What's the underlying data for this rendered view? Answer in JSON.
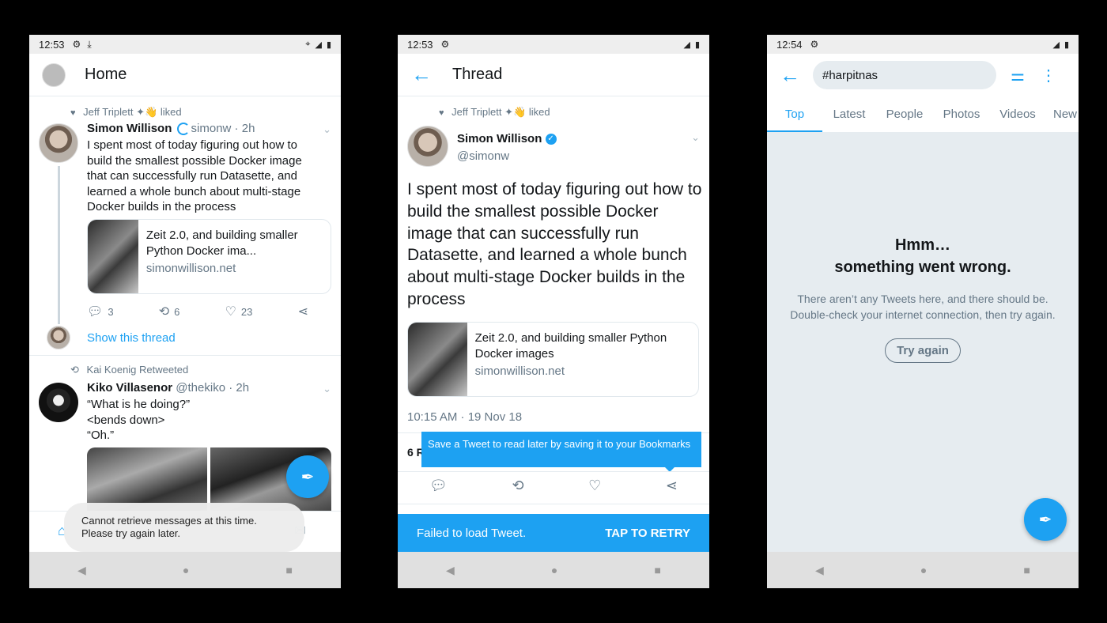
{
  "home": {
    "status": {
      "time": "12:53"
    },
    "title": "Home",
    "tweet1": {
      "social": "Jeff Triplett",
      "social_suffix": "liked",
      "name": "Simon Willison",
      "handle_time": "simonw · 2h",
      "text": "I spent most of today figuring out how to build the smallest possible Docker image that can successfully run Datasette, and learned a whole bunch about multi-stage Docker builds in the process",
      "card_title": "Zeit 2.0, and building smaller Python Docker ima...",
      "card_domain": "simonwillison.net",
      "replies": "3",
      "retweets": "6",
      "likes": "23",
      "show_thread": "Show this thread"
    },
    "tweet2": {
      "social": "Kai Koenig Retweeted",
      "name": "Kiko Villasenor",
      "handle_time": "@thekiko · 2h",
      "line1": "“What is he doing?”",
      "line2": "<bends down>",
      "line3": "“Oh.”"
    },
    "toast": {
      "line1": "Cannot retrieve messages at this time.",
      "line2": "Please try again later."
    }
  },
  "thread": {
    "status": {
      "time": "12:53"
    },
    "title": "Thread",
    "social": "Jeff Triplett",
    "social_suffix": "liked",
    "name": "Simon Willison",
    "handle": "@simonw",
    "text": "I spent most of today figuring out how to build the smallest possible Docker image that can successfully run Datasette, and learned a whole bunch about multi-stage Docker builds in the process",
    "card_title": "Zeit 2.0, and building smaller Python Docker images",
    "card_domain": "simonwillison.net",
    "timestamp": "10:15 AM · 19 Nov 18",
    "count_partial": "6 R",
    "tooltip": "Save a Tweet to read later by saving it to your Bookmarks",
    "snackbar_msg": "Failed to load Tweet.",
    "snackbar_action": "TAP TO RETRY"
  },
  "search": {
    "status": {
      "time": "12:54"
    },
    "query": "#harpitnas",
    "tabs": [
      "Top",
      "Latest",
      "People",
      "Photos",
      "Videos",
      "New"
    ],
    "error_title1": "Hmm…",
    "error_title2": "something went wrong.",
    "error_body": "There aren’t any Tweets here, and there should be. Double-check your internet connection, then try again.",
    "try_again": "Try again"
  },
  "colors": {
    "accent": "#1da1f2",
    "text": "#14171a",
    "muted": "#657786"
  }
}
